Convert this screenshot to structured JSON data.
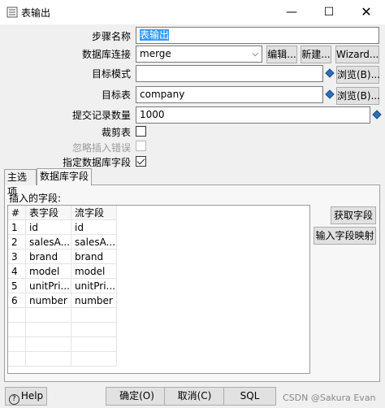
{
  "window": {
    "title": "表输出",
    "minimize": "—",
    "maximize": "☐",
    "close": "✕"
  },
  "form": {
    "step_name_label": "步骤名称",
    "step_name_value": "表输出",
    "connection_label": "数据库连接",
    "connection_value": "merge",
    "edit_button": "编辑...",
    "new_button": "新建...",
    "wizard_button": "Wizard...",
    "target_schema_label": "目标模式",
    "target_schema_value": "",
    "browse_button_1": "浏览(B)...",
    "target_table_label": "目标表",
    "target_table_value": "company",
    "browse_button_2": "浏览(B)...",
    "commit_size_label": "提交记录数量",
    "commit_size_value": "1000",
    "truncate_label": "裁剪表",
    "truncate_checked": false,
    "ignore_errors_label": "忽略插入错误",
    "ignore_errors_checked": false,
    "specify_fields_label": "指定数据库字段",
    "specify_fields_checked": true
  },
  "tabs": [
    {
      "label": "主选项"
    },
    {
      "label": "数据库字段"
    }
  ],
  "fields_panel": {
    "caption": "插入的字段:",
    "columns": [
      "#",
      "表字段",
      "流字段"
    ],
    "rows": [
      [
        "1",
        "id",
        "id"
      ],
      [
        "2",
        "salesA...",
        "salesA..."
      ],
      [
        "3",
        "brand",
        "brand"
      ],
      [
        "4",
        "model",
        "model"
      ],
      [
        "5",
        "unitPri...",
        "unitPri..."
      ],
      [
        "6",
        "number",
        "number"
      ]
    ],
    "get_fields_button": "获取字段",
    "mapping_button": "输入字段映射"
  },
  "footer": {
    "help_button": "Help",
    "ok_button": "确定(O)",
    "cancel_button": "取消(C)",
    "sql_button": "SQL"
  },
  "watermark": "CSDN @Sakura Evan"
}
